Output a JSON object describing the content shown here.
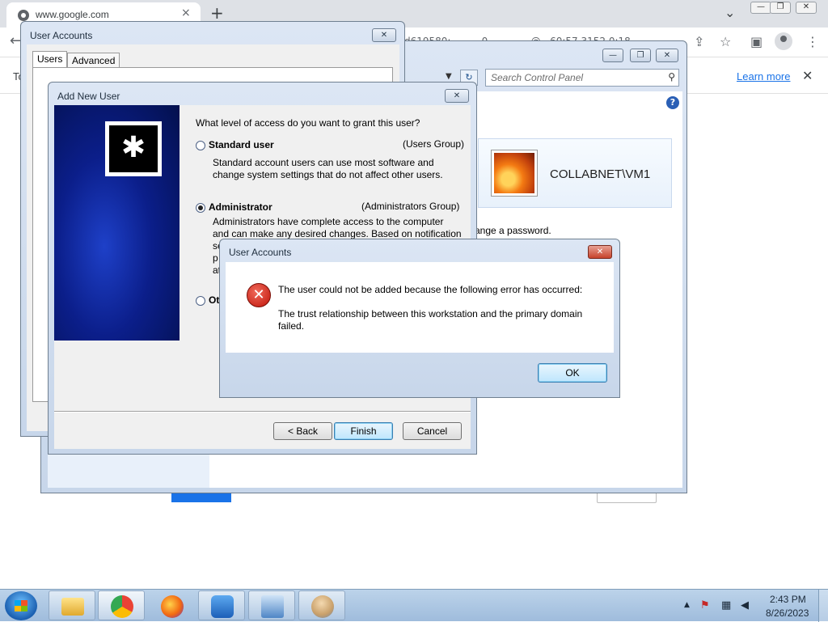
{
  "browser": {
    "tab_title": "www.google.com",
    "tab_close": "×",
    "new_tab": "+",
    "tabs_dropdown": "⌄",
    "win_minimize": "—",
    "win_restore": "❐",
    "win_close": "✕",
    "back": "←",
    "omnibox_fragment": "d619580:          0              @   60:57 3152 0:18",
    "infobar_text": "To",
    "learn_more": "Learn more",
    "infobar_close": "✕"
  },
  "control_panel": {
    "search_placeholder": "Search Control Panel",
    "help": "?",
    "user_name": "COLLABNET\\VM1",
    "change_password_fragment": "ange a password.",
    "btn_minimize": "—",
    "btn_restore": "❐",
    "btn_close": "✕"
  },
  "user_accounts": {
    "title": "User Accounts",
    "tabs": [
      "Users",
      "Advanced"
    ],
    "close": "✕"
  },
  "add_new_user": {
    "title": "Add New User",
    "close": "✕",
    "question": "What level of access do you want to grant this user?",
    "options": [
      {
        "label": "Standard user",
        "group": "(Users Group)",
        "desc": [
          "Standard account users can use most software and",
          "change system settings that do not affect other users."
        ],
        "selected": false
      },
      {
        "label": "Administrator",
        "group": "(Administrators Group)",
        "desc": [
          "Administrators have complete access to the computer",
          "and can make any desired changes. Based on notification"
        ],
        "desc_fragments": [
          "se",
          "p",
          "at"
        ],
        "selected": true
      },
      {
        "label": "Ot",
        "selected": false
      }
    ],
    "buttons": {
      "back": "< Back",
      "finish": "Finish",
      "cancel": "Cancel"
    }
  },
  "error_dialog": {
    "title": "User Accounts",
    "close": "✕",
    "icon": "✕",
    "message": "The user could not be added because the following error has occurred:",
    "detail_line1": "The trust relationship between this workstation and the primary domain",
    "detail_line2": "failed.",
    "ok": "OK"
  },
  "taskbar": {
    "apps": [
      "explorer",
      "chrome",
      "firefox",
      "security",
      "control-panel",
      "user-accounts"
    ],
    "time": "2:43 PM",
    "date": "8/26/2023",
    "tray_arrow": "▲"
  }
}
